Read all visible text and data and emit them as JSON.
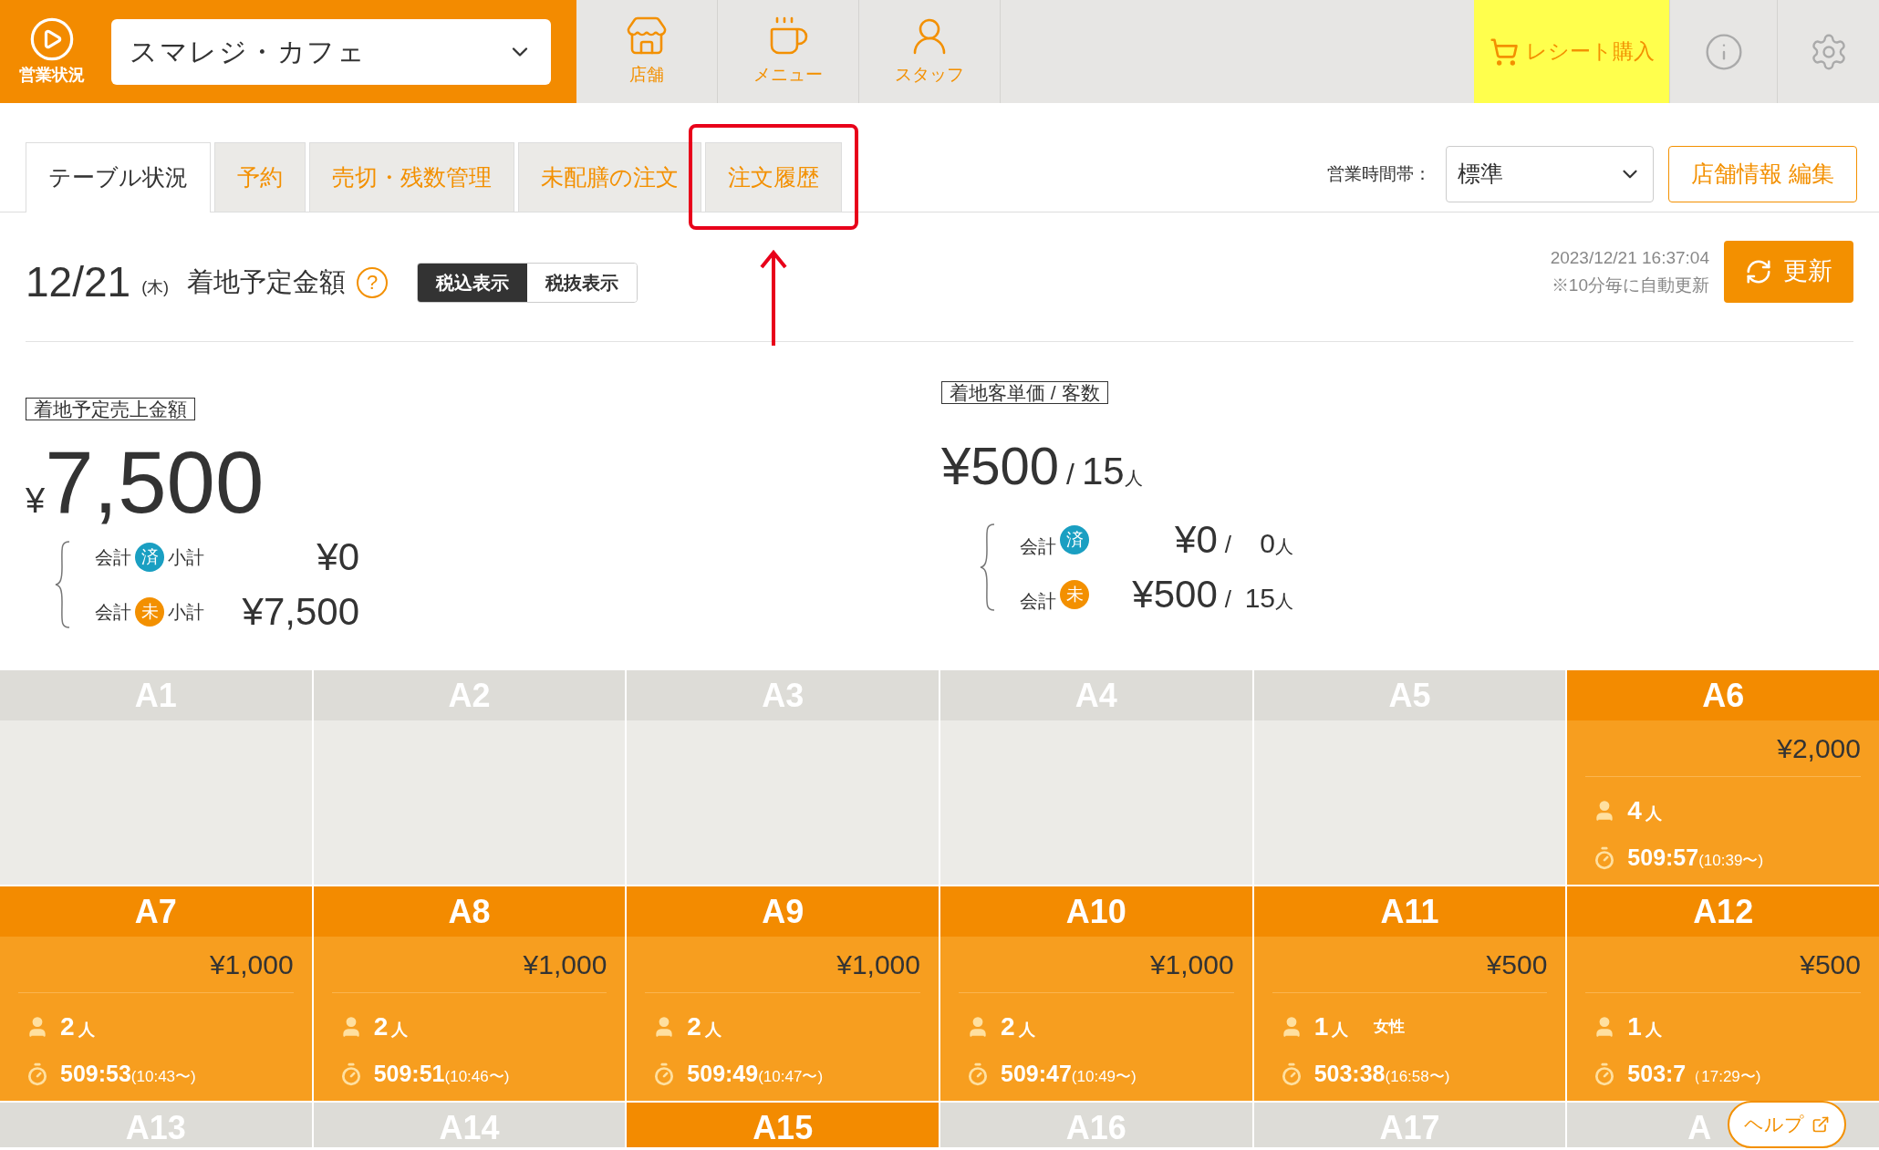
{
  "header": {
    "status_label": "営業状況",
    "store_name": "スマレジ・カフェ",
    "nav": [
      {
        "kind": "store",
        "label": "店舗"
      },
      {
        "kind": "menu",
        "label": "メニュー"
      },
      {
        "kind": "staff",
        "label": "スタッフ"
      }
    ],
    "receipt_button": "レシート購入"
  },
  "tabs": [
    {
      "label": "テーブル状況",
      "selected": true
    },
    {
      "label": "予約",
      "selected": false
    },
    {
      "label": "売切・残数管理",
      "selected": false
    },
    {
      "label": "未配膳の注文",
      "selected": false
    },
    {
      "label": "注文履歴",
      "selected": false,
      "highlighted": true
    }
  ],
  "business_hours": {
    "label": "営業時間帯：",
    "value": "標準"
  },
  "edit_button": "店舗情報 編集",
  "date_row": {
    "date": "12/21",
    "weekday": "(木)",
    "title": "着地予定金額",
    "help": "?",
    "tax_toggle": [
      {
        "label": "税込表示",
        "selected": true
      },
      {
        "label": "税抜表示",
        "selected": false
      }
    ],
    "timestamp": "2023/12/21 16:37:04",
    "auto_note": "※10分毎に自動更新",
    "refresh_button": "更新"
  },
  "sales": {
    "label": "着地予定売上金額",
    "currency": "¥",
    "amount": "7,500",
    "rows": [
      {
        "prefix": "会計",
        "badge": "済",
        "color": "#1a9fc2",
        "suffix": "小計",
        "amount": "¥0"
      },
      {
        "prefix": "会計",
        "badge": "未",
        "color": "#f39000",
        "suffix": "小計",
        "amount": "¥7,500"
      }
    ]
  },
  "per_customer": {
    "label": "着地客単価 / 客数",
    "amount": "¥500",
    "slash": "/",
    "count": "15",
    "unit": "人",
    "rows": [
      {
        "prefix": "会計",
        "badge": "済",
        "color": "#1a9fc2",
        "amount": "¥0",
        "slash": "/",
        "count": "0",
        "unit": "人"
      },
      {
        "prefix": "会計",
        "badge": "未",
        "color": "#f39000",
        "amount": "¥500",
        "slash": "/",
        "count": "15",
        "unit": "人"
      }
    ]
  },
  "tables": [
    {
      "name": "A1",
      "kind": "empty"
    },
    {
      "name": "A2",
      "kind": "empty"
    },
    {
      "name": "A3",
      "kind": "empty"
    },
    {
      "name": "A4",
      "kind": "empty"
    },
    {
      "name": "A5",
      "kind": "empty"
    },
    {
      "name": "A6",
      "kind": "occupied",
      "amount": "¥2,000",
      "count": "4",
      "unit": "人",
      "elapsed": "509:57",
      "since": "(10:39〜)"
    },
    {
      "name": "A7",
      "kind": "occupied",
      "amount": "¥1,000",
      "count": "2",
      "unit": "人",
      "elapsed": "509:53",
      "since": "(10:43〜)"
    },
    {
      "name": "A8",
      "kind": "occupied",
      "amount": "¥1,000",
      "count": "2",
      "unit": "人",
      "elapsed": "509:51",
      "since": "(10:46〜)"
    },
    {
      "name": "A9",
      "kind": "occupied",
      "amount": "¥1,000",
      "count": "2",
      "unit": "人",
      "elapsed": "509:49",
      "since": "(10:47〜)"
    },
    {
      "name": "A10",
      "kind": "occupied",
      "amount": "¥1,000",
      "count": "2",
      "unit": "人",
      "elapsed": "509:47",
      "since": "(10:49〜)"
    },
    {
      "name": "A11",
      "kind": "occupied",
      "amount": "¥500",
      "count": "1",
      "unit": "人",
      "note": "女性",
      "elapsed": "503:38",
      "since": "(16:58〜)"
    },
    {
      "name": "A12",
      "kind": "occupied",
      "amount": "¥500",
      "count": "1",
      "unit": "人",
      "elapsed": "503:7",
      "since": "（17:29〜)"
    },
    {
      "name": "A13",
      "kind": "empty_header"
    },
    {
      "name": "A14",
      "kind": "empty_header"
    },
    {
      "name": "A15",
      "kind": "occupied_header"
    },
    {
      "name": "A16",
      "kind": "empty_header"
    },
    {
      "name": "A17",
      "kind": "empty_header"
    },
    {
      "name": "A",
      "kind": "covered_header"
    }
  ],
  "help_button": "ヘルプ"
}
